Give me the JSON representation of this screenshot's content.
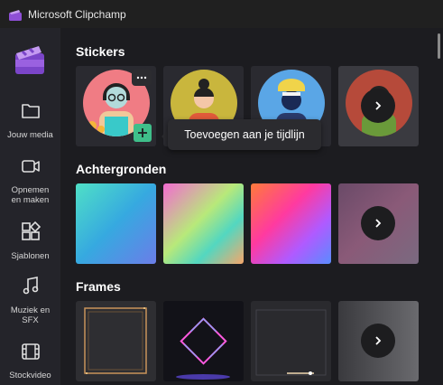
{
  "window": {
    "title": "Microsoft Clipchamp"
  },
  "sidebar": {
    "items": [
      {
        "label": "Jouw media",
        "icon": "folder-icon"
      },
      {
        "label": "Opnemen en maken",
        "icon": "camera-icon"
      },
      {
        "label": "Sjablonen",
        "icon": "templates-icon"
      },
      {
        "label": "Muziek en SFX",
        "icon": "music-icon"
      },
      {
        "label": "Stockvideo",
        "icon": "film-icon"
      }
    ]
  },
  "sections": {
    "stickers": {
      "title": "Stickers"
    },
    "backgrounds": {
      "title": "Achtergronden"
    },
    "frames": {
      "title": "Frames"
    }
  },
  "tooltip": {
    "text": "Toevoegen aan je tijdlijn"
  },
  "colors": {
    "accent": "#3fbf8a",
    "sidebar": "#24242a",
    "main": "#1c1c20"
  }
}
